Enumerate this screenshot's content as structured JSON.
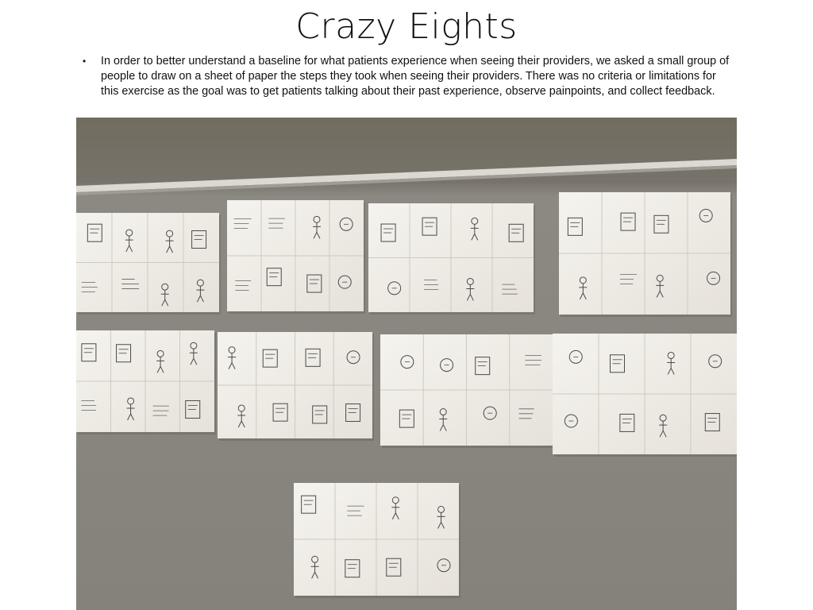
{
  "slide": {
    "title": "Crazy Eights",
    "bullets": [
      {
        "marker": "•",
        "text": "In order to better understand a baseline for what patients experience when seeing their providers, we asked a small group of people to draw on a sheet of paper the steps they took when seeing their providers. There was no criteria or limitations for this exercise as the goal was to get patients talking about their past experience, observe painpoints, and collect feedback."
      }
    ]
  },
  "photo": {
    "subject": "sketch-sheets-on-wall",
    "sheet_count": 9,
    "colors": {
      "wall": "#87847c",
      "wall_top": "#6f6a5c",
      "molding": "#d9d6cf",
      "paper": "#f1eee8",
      "pencil": "#4a4a4a"
    }
  }
}
